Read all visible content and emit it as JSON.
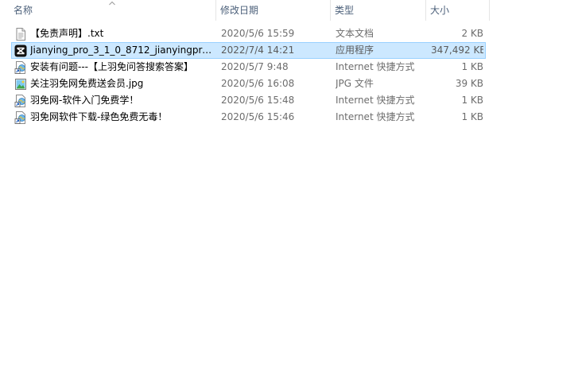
{
  "columns": {
    "name": "名称",
    "date": "修改日期",
    "type": "类型",
    "size": "大小"
  },
  "files": [
    {
      "name": "【免责声明】.txt",
      "date": "2020/5/6 15:59",
      "type": "文本文档",
      "size": "2 KB",
      "icon": "text-file-icon",
      "selected": false
    },
    {
      "name": "Jianying_pro_3_1_0_8712_jianyingpro_…",
      "date": "2022/7/4 14:21",
      "type": "应用程序",
      "size": "347,492 KB",
      "icon": "capcut-app-icon",
      "selected": true
    },
    {
      "name": "安装有问题---【上羽免问答搜索答案】",
      "date": "2020/5/7 9:48",
      "type": "Internet 快捷方式",
      "size": "1 KB",
      "icon": "internet-shortcut-icon",
      "selected": false
    },
    {
      "name": "关注羽免网免费送会员.jpg",
      "date": "2020/5/6 16:08",
      "type": "JPG 文件",
      "size": "39 KB",
      "icon": "image-file-icon",
      "selected": false
    },
    {
      "name": "羽免网-软件入门免费学！",
      "date": "2020/5/6 15:48",
      "type": "Internet 快捷方式",
      "size": "1 KB",
      "icon": "internet-shortcut-icon",
      "selected": false
    },
    {
      "name": "羽免网软件下载-绿色免费无毒！",
      "date": "2020/5/6 15:46",
      "type": "Internet 快捷方式",
      "size": "1 KB",
      "icon": "internet-shortcut-icon",
      "selected": false
    }
  ],
  "colors": {
    "header_text": "#4c607a",
    "selection_bg": "#cce8ff",
    "selection_border": "#99d1ff"
  }
}
